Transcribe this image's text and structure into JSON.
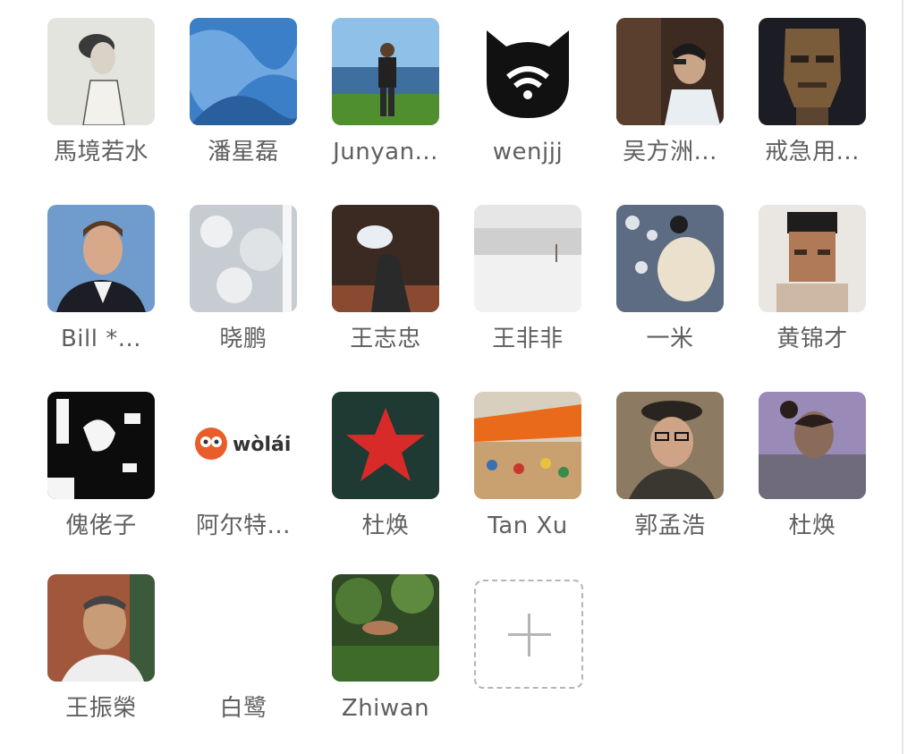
{
  "members": [
    {
      "name": "馬境若水",
      "icon": "portrait-sketch-avatar"
    },
    {
      "name": "潘星磊",
      "icon": "blue-fabric-avatar"
    },
    {
      "name": "Junyan...",
      "icon": "seaside-man-avatar"
    },
    {
      "name": "wenjjj",
      "icon": "cat-wifi-logo-avatar"
    },
    {
      "name": "吴方洲...",
      "icon": "profile-glasses-avatar"
    },
    {
      "name": "戒急用...",
      "icon": "bronze-mask-avatar"
    },
    {
      "name": "Bill *...",
      "icon": "man-portrait-avatar"
    },
    {
      "name": "晓鹏",
      "icon": "bright-texture-avatar"
    },
    {
      "name": "王志忠",
      "icon": "figure-balloon-avatar"
    },
    {
      "name": "王非非",
      "icon": "snow-yard-avatar"
    },
    {
      "name": "一米",
      "icon": "person-sitting-avatar"
    },
    {
      "name": "黄锦才",
      "icon": "pixelated-face-avatar"
    },
    {
      "name": "傀佬子",
      "icon": "black-white-avatar"
    },
    {
      "name": "阿尔特...",
      "icon": "wolai-logo-avatar",
      "logo_text": "wòlái"
    },
    {
      "name": "杜焕",
      "icon": "red-star-avatar"
    },
    {
      "name": "Tan Xu",
      "icon": "market-tent-avatar"
    },
    {
      "name": "郭孟浩",
      "icon": "old-man-hat-avatar"
    },
    {
      "name": "杜焕",
      "icon": "woman-profile-avatar"
    },
    {
      "name": "王振榮",
      "icon": "old-man-brick-avatar"
    },
    {
      "name": "白鹭",
      "icon": "blank-avatar"
    },
    {
      "name": "Zhiwan",
      "icon": "greenery-avatar"
    }
  ],
  "add_member": {
    "icon": "plus-icon"
  },
  "colors": {
    "name_text": "#5f5f5f",
    "add_border": "#b5b5b5",
    "background": "#ffffff"
  }
}
